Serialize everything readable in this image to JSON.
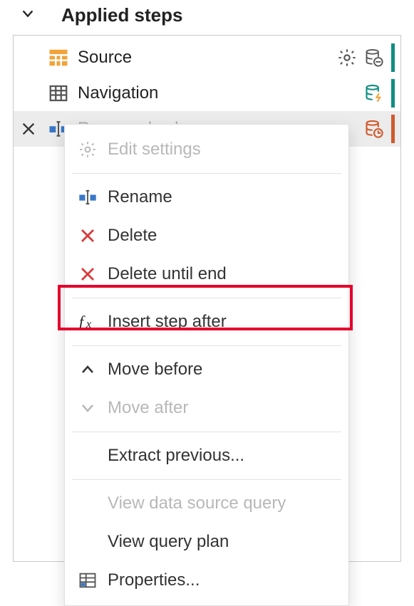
{
  "panel": {
    "title": "Applied steps"
  },
  "steps": [
    {
      "label": "Source",
      "status_icon": "db-minus",
      "accent": "teal",
      "has_gear": true
    },
    {
      "label": "Navigation",
      "status_icon": "db-bolt",
      "accent": "teal",
      "has_gear": false
    },
    {
      "label": "Renamed columns",
      "status_icon": "db-clock",
      "accent": "orange",
      "has_gear": false
    }
  ],
  "context_menu": {
    "edit_settings": "Edit settings",
    "rename": "Rename",
    "delete": "Delete",
    "delete_until_end": "Delete until end",
    "insert_step_after": "Insert step after",
    "move_before": "Move before",
    "move_after": "Move after",
    "extract_previous": "Extract previous...",
    "view_data_source_query": "View data source query",
    "view_query_plan": "View query plan",
    "properties": "Properties..."
  }
}
